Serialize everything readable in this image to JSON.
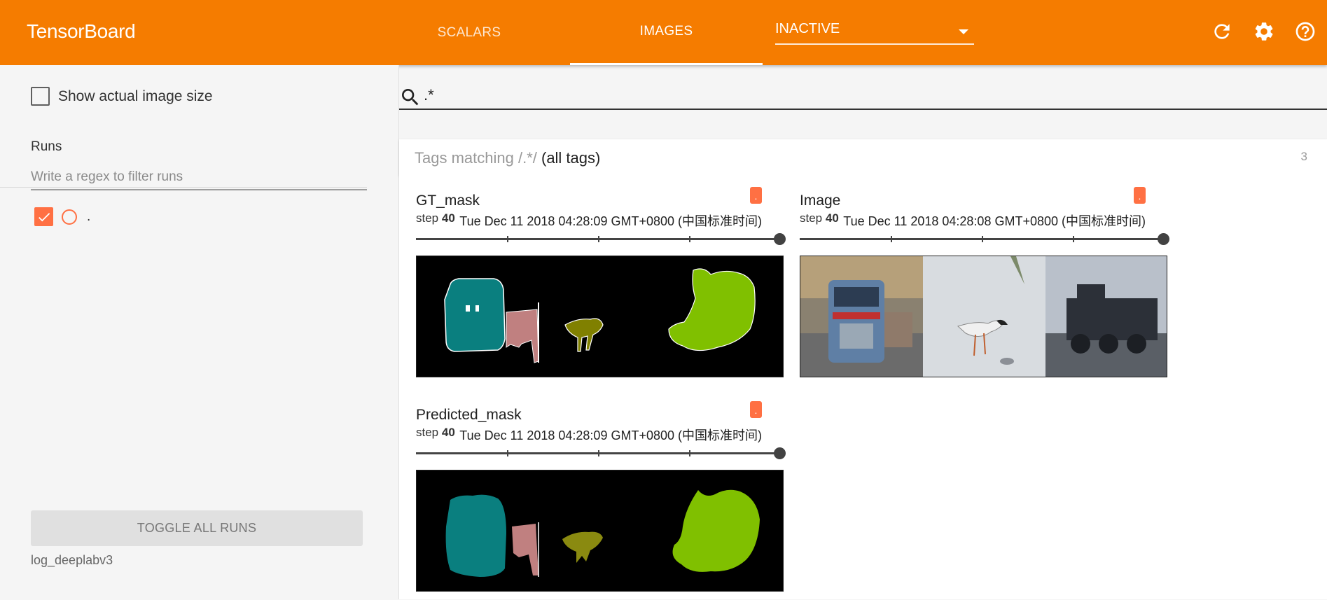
{
  "header": {
    "brand": "TensorBoard",
    "tabs": [
      {
        "label": "SCALARS",
        "active": false
      },
      {
        "label": "IMAGES",
        "active": true
      }
    ],
    "dashboard_select": "INACTIVE",
    "icons": [
      "refresh-icon",
      "gear-icon",
      "help-icon"
    ],
    "color": "#f57c00"
  },
  "sidebar": {
    "show_actual_size_label": "Show actual image size",
    "show_actual_size_checked": false,
    "runs_title": "Runs",
    "runs_filter_placeholder": "Write a regex to filter runs",
    "runs": [
      {
        "label": ".",
        "checked": true,
        "color": "#ff7043"
      }
    ],
    "toggle_all_label": "TOGGLE ALL RUNS",
    "logdir": "log_deeplabv3"
  },
  "main": {
    "search_value": ".*",
    "tags_card": {
      "prefix": "Tags matching /.*/",
      "suffix": " (all tags)",
      "count": "3"
    },
    "cards": [
      {
        "tag": "GT_mask",
        "step_label": "step",
        "step": "40",
        "timestamp": "Tue Dec 11 2018 04:28:09 GMT+0800 (中国标准时间)",
        "run": "."
      },
      {
        "tag": "Image",
        "step_label": "step",
        "step": "40",
        "timestamp": "Tue Dec 11 2018 04:28:08 GMT+0800 (中国标准时间)",
        "run": "."
      },
      {
        "tag": "Predicted_mask",
        "step_label": "step",
        "step": "40",
        "timestamp": "Tue Dec 11 2018 04:28:09 GMT+0800 (中国标准时间)",
        "run": "."
      }
    ]
  }
}
